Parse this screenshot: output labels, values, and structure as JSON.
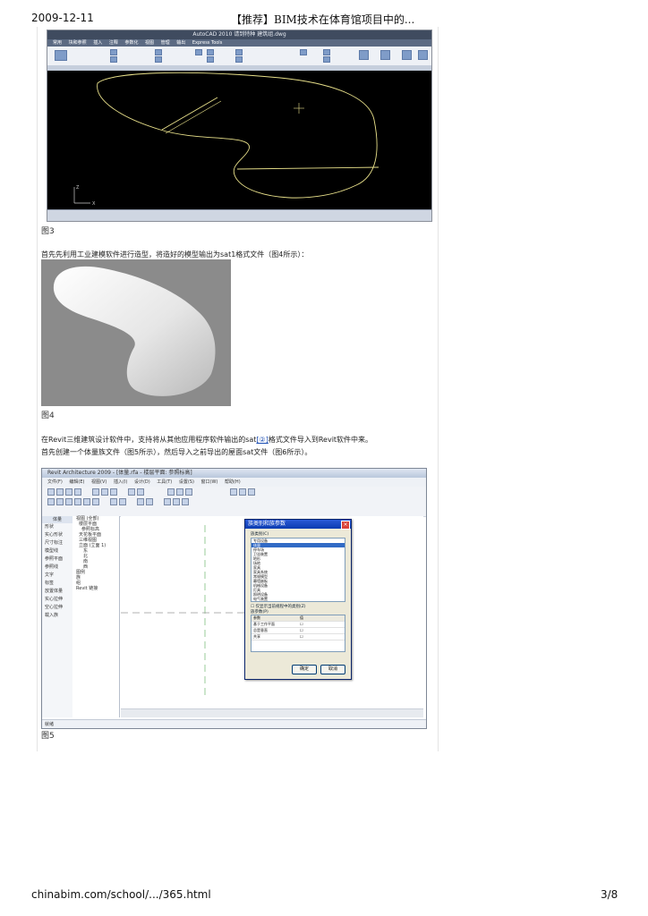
{
  "header": {
    "date": "2009-12-11",
    "title": "【推荐】BIM技术在体育馆项目中的..."
  },
  "figure3": {
    "caption": "图3",
    "app_title": "AutoCAD 2010   请到特种  建筑组.dwg",
    "menu_items": [
      "常用",
      "块和参照",
      "插入",
      "注释",
      "参数化",
      "视图",
      "管理",
      "输出",
      "Express Tools"
    ]
  },
  "intro_text": "首先先利用工业建模软件进行造型，将造好的模型输出为sat1格式文件（图4所示）：",
  "figure4": {
    "caption": "图4"
  },
  "revit_text": {
    "line1_before": "在Revit三维建筑设计软件中，支持将从其他应用程序软件输出的sat",
    "link": "[②]",
    "line1_after": "格式文件导入到Revit软件中来。",
    "line2": "首先创建一个体量族文件（图5所示），然后导入之前导出的屋面sat文件（图6所示）。"
  },
  "figure5": {
    "caption": "图5",
    "app_title": "Revit Architecture 2009 - [体量.rfa - 楼层平面: 参照标高]",
    "menu_items": [
      "文件(F)",
      "编辑(E)",
      "视图(V)",
      "插入(I)",
      "设计(D)",
      "工具(T)",
      "设置(S)",
      "窗口(W)",
      "帮助(H)"
    ],
    "design_bar_header": "体量",
    "design_bar_items": [
      "形状",
      "实心形状",
      "尺寸标注",
      "模型线",
      "参照平面",
      "参照线",
      "文字",
      "标签",
      "放置体量",
      "实心拉伸",
      "空心拉伸",
      "载入族"
    ],
    "browser_items": [
      "视图 (全部)",
      "楼层平面",
      "参照标高",
      "天花板平面",
      "三维视图",
      "立面 (立面 1)",
      "东",
      "北",
      "南",
      "西",
      "图例",
      "族",
      "组",
      "Revit 链接"
    ],
    "status": "就绪",
    "dialog": {
      "title": "族类别和族参数",
      "category_label": "族类别(C)",
      "categories": [
        "专用设备",
        "体量",
        "停车场",
        "卫浴装置",
        "地形",
        "场地",
        "家具",
        "家具系统",
        "常规模型",
        "幕墙嵌板",
        "机械设备",
        "灯具",
        "照明设备",
        "电气装置",
        "电气设备",
        "窗",
        "门"
      ],
      "selected_category": "体量",
      "filter_label": "仅显示当前规程中的类别(Z)",
      "param_label": "族参数(P)",
      "param_headers": [
        "参数",
        "值"
      ],
      "params": [
        [
          "基于工作平面",
          ""
        ],
        [
          "总是垂直",
          ""
        ],
        [
          "共享",
          ""
        ]
      ],
      "ok": "确定",
      "cancel": "取消"
    }
  },
  "footer": {
    "url": "chinabim.com/school/.../365.html",
    "page": "3/8"
  },
  "colors": {
    "cad_background": "#000000",
    "cad_curve": "#e8e08a",
    "render_background": "#8b8b8b"
  }
}
